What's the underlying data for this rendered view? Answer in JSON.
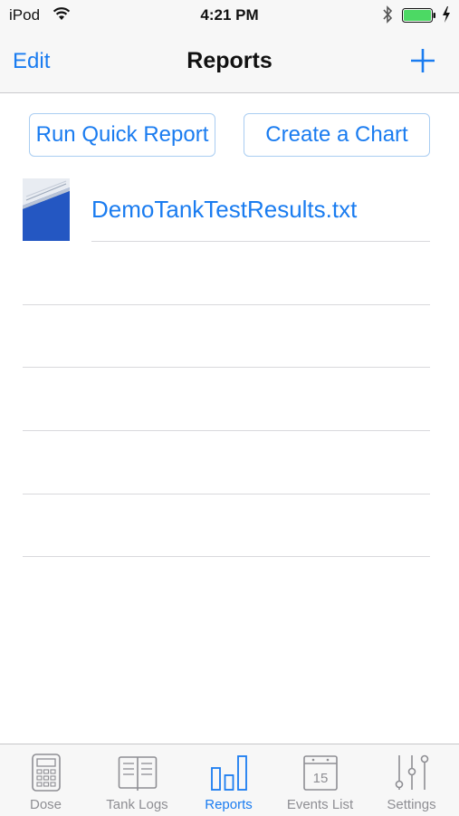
{
  "status_bar": {
    "carrier": "iPod",
    "time": "4:21 PM",
    "icons": [
      "wifi-icon",
      "bluetooth-icon",
      "battery-icon",
      "charging-icon"
    ]
  },
  "nav": {
    "edit_label": "Edit",
    "title": "Reports",
    "add_icon": "plus-icon"
  },
  "actions": {
    "quick_report_label": "Run Quick Report",
    "chart_label": "Create a Chart"
  },
  "reports": [
    {
      "name": "DemoTankTestResults.txt",
      "thumbnail": "report-thumbnail"
    }
  ],
  "tabs": [
    {
      "label": "Dose",
      "icon": "calculator-icon",
      "active": false
    },
    {
      "label": "Tank Logs",
      "icon": "book-icon",
      "active": false
    },
    {
      "label": "Reports",
      "icon": "bar-chart-icon",
      "active": true
    },
    {
      "label": "Events List",
      "icon": "calendar-icon",
      "calendar_day": "15",
      "active": false
    },
    {
      "label": "Settings",
      "icon": "sliders-icon",
      "active": false
    }
  ],
  "colors": {
    "accent": "#1a7cf0",
    "inactive_tab": "#8e8e93",
    "bar_background": "#f7f7f7",
    "battery": "#4cd964"
  }
}
